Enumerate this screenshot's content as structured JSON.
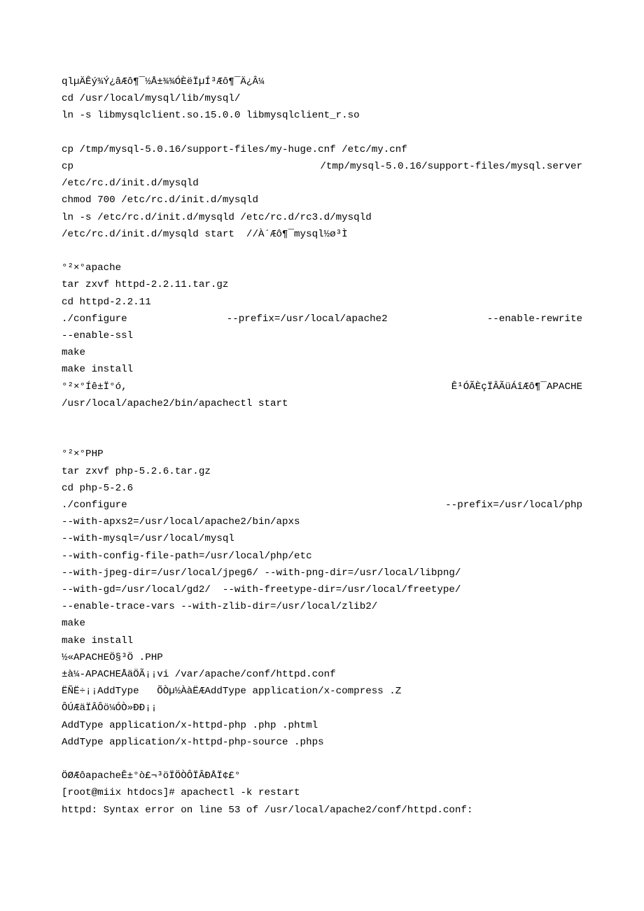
{
  "lines": [
    {
      "type": "plain",
      "text": "qlµÄÊý¾Ý¿âÆô¶¯½Å±¾¾ÓÈëÏµÍ³Æô¶¯Ä¿Â¼"
    },
    {
      "type": "plain",
      "text": "cd /usr/local/mysql/lib/mysql/"
    },
    {
      "type": "plain",
      "text": "ln -s libmysqlclient.so.15.0.0 libmysqlclient_r.so"
    },
    {
      "type": "blank"
    },
    {
      "type": "plain",
      "text": "cp /tmp/mysql-5.0.16/support-files/my-huge.cnf /etc/my.cnf"
    },
    {
      "type": "just",
      "parts": [
        "cp",
        "/tmp/mysql-5.0.16/support-files/mysql.server"
      ]
    },
    {
      "type": "plain",
      "text": "/etc/rc.d/init.d/mysqld"
    },
    {
      "type": "plain",
      "text": "chmod 700 /etc/rc.d/init.d/mysqld"
    },
    {
      "type": "plain",
      "text": "ln -s /etc/rc.d/init.d/mysqld /etc/rc.d/rc3.d/mysqld"
    },
    {
      "type": "plain",
      "text": "/etc/rc.d/init.d/mysqld start  //À´Æô¶¯mysql½ø³Ì"
    },
    {
      "type": "blank"
    },
    {
      "type": "plain",
      "text": "°²×°apache"
    },
    {
      "type": "plain",
      "text": "tar zxvf httpd-2.2.11.tar.gz"
    },
    {
      "type": "plain",
      "text": "cd httpd-2.2.11"
    },
    {
      "type": "just",
      "parts": [
        "./configure",
        "--prefix=/usr/local/apache2",
        "--enable-rewrite"
      ]
    },
    {
      "type": "plain",
      "text": "--enable-ssl"
    },
    {
      "type": "plain",
      "text": "make"
    },
    {
      "type": "plain",
      "text": "make install"
    },
    {
      "type": "just",
      "parts": [
        "°²×°Íê±Ï°ó,",
        "Ê¹ÓÃÈçÏÂÃüÁîÆô¶¯APACHE"
      ]
    },
    {
      "type": "plain",
      "text": "/usr/local/apache2/bin/apachectl start"
    },
    {
      "type": "blank"
    },
    {
      "type": "blank"
    },
    {
      "type": "plain",
      "text": "°²×°PHP"
    },
    {
      "type": "plain",
      "text": "tar zxvf php-5.2.6.tar.gz"
    },
    {
      "type": "plain",
      "text": "cd php-5-2.6"
    },
    {
      "type": "just",
      "parts": [
        "./configure",
        "--prefix=/usr/local/php"
      ]
    },
    {
      "type": "plain",
      "text": "--with-apxs2=/usr/local/apache2/bin/apxs"
    },
    {
      "type": "plain",
      "text": "--with-mysql=/usr/local/mysql"
    },
    {
      "type": "plain",
      "text": "--with-config-file-path=/usr/local/php/etc"
    },
    {
      "type": "plain",
      "text": "--with-jpeg-dir=/usr/local/jpeg6/ --with-png-dir=/usr/local/libpng/"
    },
    {
      "type": "plain",
      "text": "--with-gd=/usr/local/gd2/  --with-freetype-dir=/usr/local/freetype/"
    },
    {
      "type": "plain",
      "text": "--enable-trace-vars --with-zlib-dir=/usr/local/zlib2/"
    },
    {
      "type": "plain",
      "text": "make"
    },
    {
      "type": "plain",
      "text": "make install"
    },
    {
      "type": "plain",
      "text": "½«APACHEÖ§³Ö .PHP"
    },
    {
      "type": "plain",
      "text": "±à¼-APACHEÅäÖÃ¡¡vi /var/apache/conf/httpd.conf"
    },
    {
      "type": "plain",
      "text": "ËÑË÷¡¡AddType   ÕÒµ½ÀàËÆAddType application/x-compress .Z"
    },
    {
      "type": "plain",
      "text": "ÔÚÆäÏÂÔö¼ÓÒ»ÐÐ¡¡"
    },
    {
      "type": "plain",
      "text": "AddType application/x-httpd-php .php .phtml"
    },
    {
      "type": "plain",
      "text": "AddType application/x-httpd-php-source .phps"
    },
    {
      "type": "blank"
    },
    {
      "type": "plain",
      "text": "ÖØÆôapacheÊ±°ò£¬³öÏÖÒÔÏÂÐÅÏ¢£°"
    },
    {
      "type": "plain",
      "text": "[root@miix htdocs]# apachectl -k restart"
    },
    {
      "type": "plain",
      "text": "httpd: Syntax error on line 53 of /usr/local/apache2/conf/httpd.conf:"
    }
  ]
}
